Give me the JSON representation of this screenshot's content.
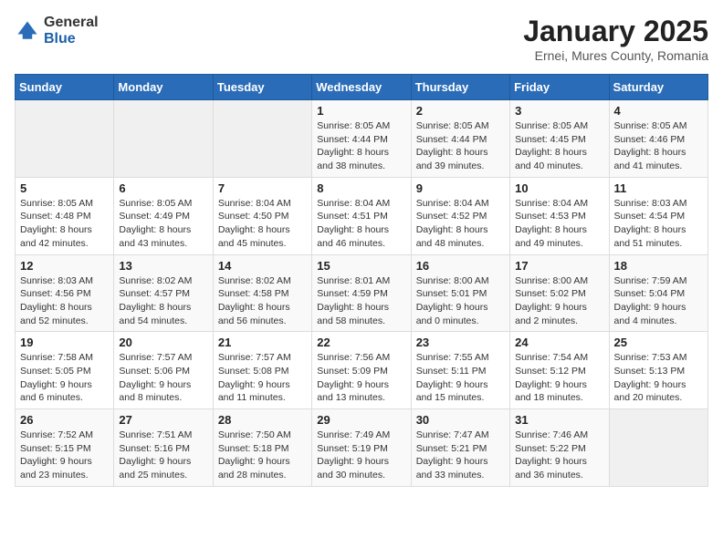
{
  "logo": {
    "general": "General",
    "blue": "Blue"
  },
  "header": {
    "title": "January 2025",
    "location": "Ernei, Mures County, Romania"
  },
  "days_of_week": [
    "Sunday",
    "Monday",
    "Tuesday",
    "Wednesday",
    "Thursday",
    "Friday",
    "Saturday"
  ],
  "weeks": [
    [
      {
        "day": "",
        "info": ""
      },
      {
        "day": "",
        "info": ""
      },
      {
        "day": "",
        "info": ""
      },
      {
        "day": "1",
        "info": "Sunrise: 8:05 AM\nSunset: 4:44 PM\nDaylight: 8 hours\nand 38 minutes."
      },
      {
        "day": "2",
        "info": "Sunrise: 8:05 AM\nSunset: 4:44 PM\nDaylight: 8 hours\nand 39 minutes."
      },
      {
        "day": "3",
        "info": "Sunrise: 8:05 AM\nSunset: 4:45 PM\nDaylight: 8 hours\nand 40 minutes."
      },
      {
        "day": "4",
        "info": "Sunrise: 8:05 AM\nSunset: 4:46 PM\nDaylight: 8 hours\nand 41 minutes."
      }
    ],
    [
      {
        "day": "5",
        "info": "Sunrise: 8:05 AM\nSunset: 4:48 PM\nDaylight: 8 hours\nand 42 minutes."
      },
      {
        "day": "6",
        "info": "Sunrise: 8:05 AM\nSunset: 4:49 PM\nDaylight: 8 hours\nand 43 minutes."
      },
      {
        "day": "7",
        "info": "Sunrise: 8:04 AM\nSunset: 4:50 PM\nDaylight: 8 hours\nand 45 minutes."
      },
      {
        "day": "8",
        "info": "Sunrise: 8:04 AM\nSunset: 4:51 PM\nDaylight: 8 hours\nand 46 minutes."
      },
      {
        "day": "9",
        "info": "Sunrise: 8:04 AM\nSunset: 4:52 PM\nDaylight: 8 hours\nand 48 minutes."
      },
      {
        "day": "10",
        "info": "Sunrise: 8:04 AM\nSunset: 4:53 PM\nDaylight: 8 hours\nand 49 minutes."
      },
      {
        "day": "11",
        "info": "Sunrise: 8:03 AM\nSunset: 4:54 PM\nDaylight: 8 hours\nand 51 minutes."
      }
    ],
    [
      {
        "day": "12",
        "info": "Sunrise: 8:03 AM\nSunset: 4:56 PM\nDaylight: 8 hours\nand 52 minutes."
      },
      {
        "day": "13",
        "info": "Sunrise: 8:02 AM\nSunset: 4:57 PM\nDaylight: 8 hours\nand 54 minutes."
      },
      {
        "day": "14",
        "info": "Sunrise: 8:02 AM\nSunset: 4:58 PM\nDaylight: 8 hours\nand 56 minutes."
      },
      {
        "day": "15",
        "info": "Sunrise: 8:01 AM\nSunset: 4:59 PM\nDaylight: 8 hours\nand 58 minutes."
      },
      {
        "day": "16",
        "info": "Sunrise: 8:00 AM\nSunset: 5:01 PM\nDaylight: 9 hours\nand 0 minutes."
      },
      {
        "day": "17",
        "info": "Sunrise: 8:00 AM\nSunset: 5:02 PM\nDaylight: 9 hours\nand 2 minutes."
      },
      {
        "day": "18",
        "info": "Sunrise: 7:59 AM\nSunset: 5:04 PM\nDaylight: 9 hours\nand 4 minutes."
      }
    ],
    [
      {
        "day": "19",
        "info": "Sunrise: 7:58 AM\nSunset: 5:05 PM\nDaylight: 9 hours\nand 6 minutes."
      },
      {
        "day": "20",
        "info": "Sunrise: 7:57 AM\nSunset: 5:06 PM\nDaylight: 9 hours\nand 8 minutes."
      },
      {
        "day": "21",
        "info": "Sunrise: 7:57 AM\nSunset: 5:08 PM\nDaylight: 9 hours\nand 11 minutes."
      },
      {
        "day": "22",
        "info": "Sunrise: 7:56 AM\nSunset: 5:09 PM\nDaylight: 9 hours\nand 13 minutes."
      },
      {
        "day": "23",
        "info": "Sunrise: 7:55 AM\nSunset: 5:11 PM\nDaylight: 9 hours\nand 15 minutes."
      },
      {
        "day": "24",
        "info": "Sunrise: 7:54 AM\nSunset: 5:12 PM\nDaylight: 9 hours\nand 18 minutes."
      },
      {
        "day": "25",
        "info": "Sunrise: 7:53 AM\nSunset: 5:13 PM\nDaylight: 9 hours\nand 20 minutes."
      }
    ],
    [
      {
        "day": "26",
        "info": "Sunrise: 7:52 AM\nSunset: 5:15 PM\nDaylight: 9 hours\nand 23 minutes."
      },
      {
        "day": "27",
        "info": "Sunrise: 7:51 AM\nSunset: 5:16 PM\nDaylight: 9 hours\nand 25 minutes."
      },
      {
        "day": "28",
        "info": "Sunrise: 7:50 AM\nSunset: 5:18 PM\nDaylight: 9 hours\nand 28 minutes."
      },
      {
        "day": "29",
        "info": "Sunrise: 7:49 AM\nSunset: 5:19 PM\nDaylight: 9 hours\nand 30 minutes."
      },
      {
        "day": "30",
        "info": "Sunrise: 7:47 AM\nSunset: 5:21 PM\nDaylight: 9 hours\nand 33 minutes."
      },
      {
        "day": "31",
        "info": "Sunrise: 7:46 AM\nSunset: 5:22 PM\nDaylight: 9 hours\nand 36 minutes."
      },
      {
        "day": "",
        "info": ""
      }
    ]
  ]
}
